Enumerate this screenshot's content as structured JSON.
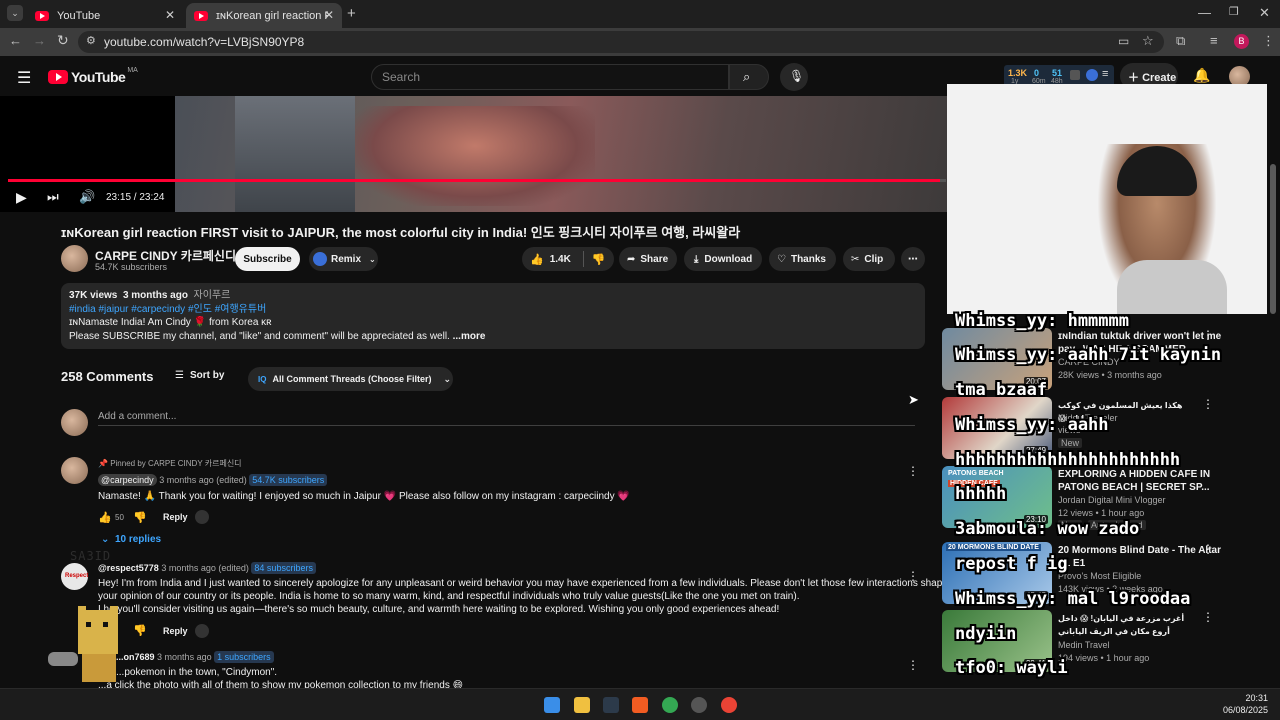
{
  "browser": {
    "tabs": [
      {
        "label": "YouTube"
      },
      {
        "label": "ɪɴKorean girl reaction FIRST visi"
      }
    ],
    "url": "youtube.com/watch?v=LVBjSN90YP8",
    "profile_initial": "B"
  },
  "header": {
    "logo_text": "YouTube",
    "logo_region": "MA",
    "search_placeholder": "Search",
    "stats": {
      "a": "1.3K",
      "a_sub": "1y",
      "b": "0",
      "b_sub": "60m",
      "c": "51",
      "c_sub": "48h"
    },
    "create_label": "Create"
  },
  "player": {
    "time": "23:15 / 23:24",
    "progress_fraction": 0.9936
  },
  "video": {
    "title": "ɪɴKorean girl reaction FIRST visit to JAIPUR, the most colorful city in India! 인도 핑크시티 자이푸르 여행, 라씨왈라",
    "channel_name": "CARPE CINDY 카르페신디",
    "subscribers": "54.7K subscribers",
    "subscribe_label": "Subscribe",
    "remix_label": "Remix",
    "likes": "1.4K",
    "share_label": "Share",
    "download_label": "Download",
    "thanks_label": "Thanks",
    "clip_label": "Clip"
  },
  "description": {
    "views": "37K views",
    "date": "3 months ago",
    "location": "자이푸르",
    "hashtags": "#india #jaipur #carpecindy #인도 #여행유튜버",
    "line1_a": "ɪɴNamaste India! Am Cindy",
    "line1_b": "from Korea ᴋʀ",
    "line2": "Please SUBSCRIBE my channel, and \"like\" and comment\" will be appreciated as well.",
    "more_label": "...more"
  },
  "comments": {
    "count_label": "258 Comments",
    "sort_label": "Sort by",
    "filter_label": "All Comment Threads (Choose Filter)",
    "add_placeholder": "Add a comment...",
    "items": [
      {
        "pinned": "Pinned by CARPE CINDY 카르페신디",
        "author": "@carpecindy",
        "time": "3 months ago (edited)",
        "subs": "54.7K subscribers",
        "text": "Namaste! 🙏 Thank you for waiting! I enjoyed so much in Jaipur 💗 Please also follow on my instagram : carpeciindy 💗",
        "likes": "50",
        "reply_label": "Reply",
        "replies_label": "10 replies"
      },
      {
        "author": "@respect5778",
        "time": "3 months ago (edited)",
        "subs": "84 subscribers",
        "line1": "Hey! I'm from India and I just wanted to sincerely apologize for any unpleasant or weird behavior you may have experienced from a few individuals. Please don't let those few interactions shape",
        "line2": "your opinion of our country or its people. India is home to so many warm, kind, and respectful individuals who truly value guests(Like the one you met on train).",
        "line3": "I ho    you'll consider visiting us again—there's so much beauty, culture, and warmth here waiting to be explored. Wishing you only good experiences ahead!",
        "reply_label": "Reply"
      },
      {
        "author": "...on7689",
        "time": "3 months ago",
        "subs": "1 subscribers",
        "line1": "...pokemon in the town, \"Cindymon\".",
        "line2": "...a click the photo with all of them to show my pokemon collection to my friends 😄"
      }
    ]
  },
  "recommendations": [
    {
      "title": "ɪɴIndian tuktuk driver won't let me pay.. WAS HE A SCAMMER...",
      "channel": "CARPE CINDY",
      "meta": "28K views • 3 months ago",
      "duration": "20:07"
    },
    {
      "title": "هكذا يعيش المسلمون في كوكب اليابان 😱",
      "channel": "Midou Traveler",
      "meta": "views",
      "badge": "New",
      "duration": "27:49"
    },
    {
      "title": "EXPLORING A HIDDEN CAFE IN PATONG BEACH | SECRET SP...",
      "channel": "Jordan Digital Mini Vlogger",
      "meta": "12 views • 1 hour ago",
      "badge": "New",
      "badge2": "Auto-dubbed",
      "duration": "23:10",
      "thumb_text1": "PATONG BEACH",
      "thumb_text2": "HIDDEN CAFE"
    },
    {
      "title": "20 Mormons Blind Date - The Altar S1 E1",
      "channel": "Provo's Most Eligible",
      "meta": "143K views • 2 weeks ago",
      "duration": "45:45",
      "thumb_text1": "20 MORMONS BLIND DATE"
    },
    {
      "title": "أغرب مزرعة في اليابان! 😱 داخل أروع مكان في الريف الياباني",
      "channel": "Medin Travel",
      "meta": "194 views • 1 hour ago",
      "duration": "39:41"
    }
  ],
  "chat_overlay": [
    {
      "text": "Whimss_yy: hmmmmm"
    },
    {
      "text": "Whimss_yy: aahh 7it kaynin"
    },
    {
      "text": "tma bzaaf"
    },
    {
      "text": "Whimss_yy: aahh"
    },
    {
      "text": "hhhhhhhhhhhhhhhhhhhhhh"
    },
    {
      "text": "hhhhh"
    },
    {
      "text": "3abmoula: wow zado"
    },
    {
      "text": "repost f ig"
    },
    {
      "text": "Whimss_yy: mal l9roodaa"
    },
    {
      "text": "ndyiin"
    },
    {
      "text": "tfo0: wayli"
    }
  ],
  "watermark": "SA3ID",
  "taskbar": {
    "time": "20:31",
    "date": "06/08/2025"
  },
  "colors": {
    "accent": "#ff0033",
    "link": "#3ea6ff",
    "bg": "#0f0f0f"
  }
}
